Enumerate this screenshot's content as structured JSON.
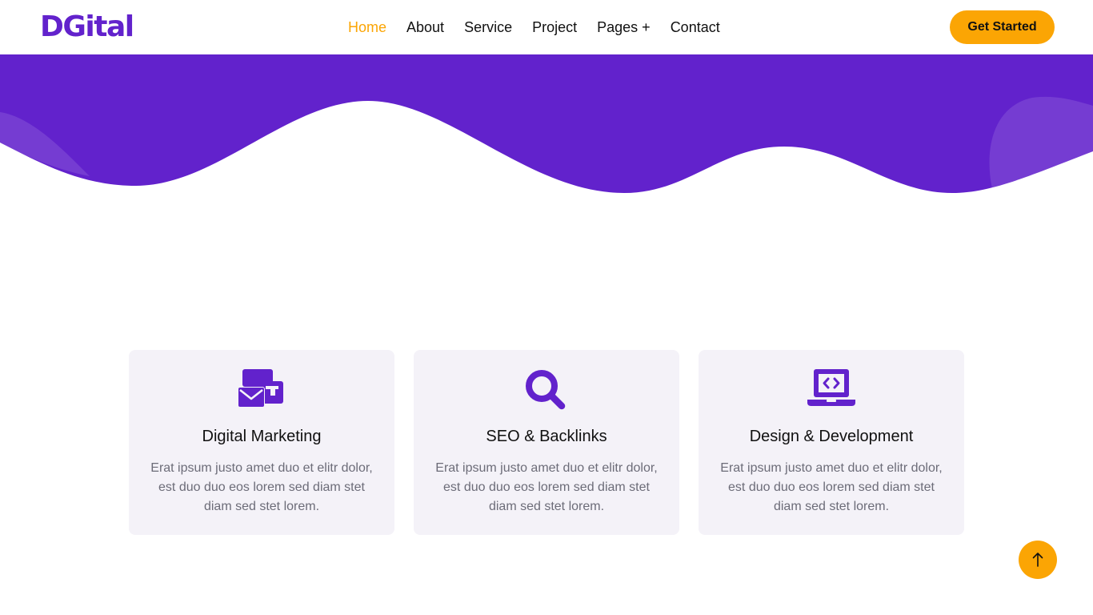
{
  "brand": {
    "name": "DGital"
  },
  "nav": {
    "links": [
      {
        "label": "Home",
        "active": true
      },
      {
        "label": "About"
      },
      {
        "label": "Service"
      },
      {
        "label": "Project"
      },
      {
        "label": "Pages"
      },
      {
        "label": "Contact"
      }
    ],
    "pages_suffix": "+",
    "cta_label": "Get Started"
  },
  "colors": {
    "primary": "#6222cc",
    "accent": "#fba504",
    "card_bg": "#f4f2f8",
    "text_dark": "#111111",
    "text_muted": "#6c6c78"
  },
  "services": [
    {
      "icon": "mail-bulk-icon",
      "title": "Digital Marketing",
      "text": "Erat ipsum justo amet duo et elitr dolor, est duo duo eos lorem sed diam stet diam sed stet lorem."
    },
    {
      "icon": "search-icon",
      "title": "SEO & Backlinks",
      "text": "Erat ipsum justo amet duo et elitr dolor, est duo duo eos lorem sed diam stet diam sed stet lorem."
    },
    {
      "icon": "laptop-code-icon",
      "title": "Design & Development",
      "text": "Erat ipsum justo amet duo et elitr dolor, est duo duo eos lorem sed diam stet diam sed stet lorem."
    }
  ],
  "back_to_top": {
    "icon": "arrow-up-icon"
  }
}
